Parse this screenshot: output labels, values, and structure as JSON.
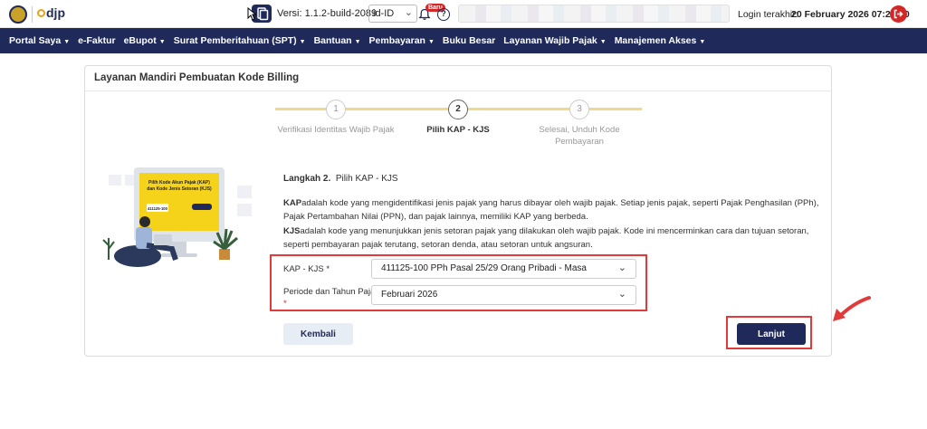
{
  "header": {
    "logo_text": "djp",
    "version_label": "Versi:",
    "version_value": "1.1.2-build-2089",
    "language": "id-ID",
    "new_badge": "Baru",
    "help_icon": "question-circle-icon",
    "last_login_label": "Login terakhir:",
    "last_login_value": "20 February 2026 07:20:50"
  },
  "nav": {
    "items": [
      {
        "label": "Portal Saya",
        "dropdown": true
      },
      {
        "label": "e-Faktur",
        "dropdown": false
      },
      {
        "label": "eBupot",
        "dropdown": true
      },
      {
        "label": "Surat Pemberitahuan (SPT)",
        "dropdown": true
      },
      {
        "label": "Bantuan",
        "dropdown": true
      },
      {
        "label": "Pembayaran",
        "dropdown": true
      },
      {
        "label": "Buku Besar",
        "dropdown": false
      },
      {
        "label": "Layanan Wajib Pajak",
        "dropdown": true
      },
      {
        "label": "Manajemen Akses",
        "dropdown": true
      }
    ]
  },
  "card": {
    "title": "Layanan Mandiri Pembuatan Kode Billing"
  },
  "stepper": {
    "steps": [
      {
        "number": "1",
        "label": "Verifikasi Identitas Wajib Pajak",
        "active": false
      },
      {
        "number": "2",
        "label": "Pilih KAP - KJS",
        "active": true
      },
      {
        "number": "3",
        "label": "Selesai, Unduh Kode Pembayaran",
        "active": false
      }
    ]
  },
  "illustration": {
    "screen_line1": "Pilih Kode Akun Pajak (KAP)",
    "screen_line2": "dan Kode Jenis Setoran (KJS)",
    "screen_code": "411125-100"
  },
  "content": {
    "step_prefix": "Langkah 2.",
    "step_title": "Pilih KAP - KJS",
    "kap_term": "KAP",
    "kap_desc": "adalah kode yang mengidentifikasi jenis pajak yang harus dibayar oleh wajib pajak. Setiap jenis pajak, seperti Pajak Penghasilan (PPh), Pajak Pertambahan Nilai (PPN), dan pajak lainnya, memiliki KAP yang berbeda.",
    "kjs_term": "KJS",
    "kjs_desc": "adalah kode yang menunjukkan jenis setoran pajak yang dilakukan oleh wajib pajak. Kode ini mencerminkan cara dan tujuan setoran, seperti pembayaran pajak terutang, setoran denda, atau setoran untuk angsuran."
  },
  "form": {
    "kap_label": "KAP - KJS",
    "kap_required": "*",
    "kap_value": "411125-100 PPh Pasal 25/29 Orang Pribadi - Masa",
    "periode_label": "Periode dan Tahun Pajak",
    "periode_required": "*",
    "periode_value": "Februari 2026"
  },
  "buttons": {
    "back": "Kembali",
    "next": "Lanjut"
  },
  "colors": {
    "navy": "#1f2a5a",
    "annotation_red": "#e03a3a",
    "step_line": "#f0d98a",
    "illus_yellow": "#f5d31a"
  }
}
